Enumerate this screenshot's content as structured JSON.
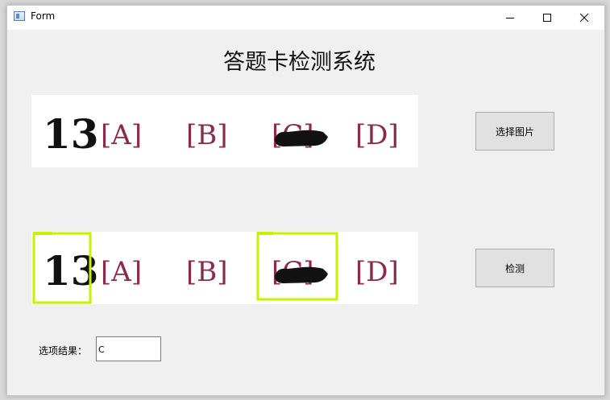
{
  "window": {
    "title": "Form",
    "icon": "app-window-icon"
  },
  "controls": {
    "minimize": "minimize-icon",
    "maximize": "maximize-icon",
    "close": "close-icon"
  },
  "heading": "答题卡检测系统",
  "sheet": {
    "question_number": "13",
    "options": [
      "[A]",
      "[B]",
      "[C]",
      "[D]"
    ],
    "filled_option": "C"
  },
  "buttons": {
    "select_image": "选择图片",
    "detect": "检测"
  },
  "result": {
    "label": "选项结果：",
    "value": "C"
  },
  "colors": {
    "option_ink": "#8a2b4a",
    "detection_box": "#c8f000",
    "mark_ink": "#111111"
  }
}
